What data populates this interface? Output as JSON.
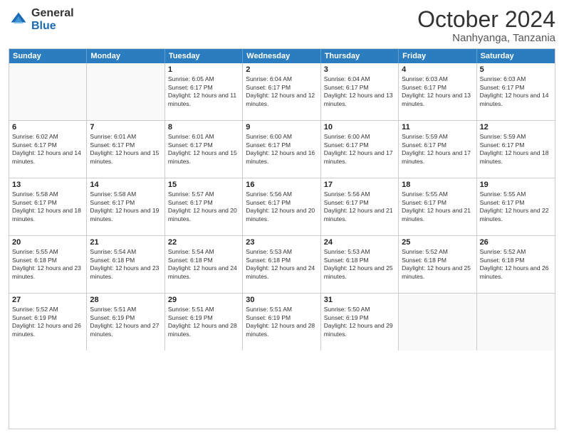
{
  "logo": {
    "general": "General",
    "blue": "Blue"
  },
  "header": {
    "month": "October 2024",
    "location": "Nanhyanga, Tanzania"
  },
  "days": [
    "Sunday",
    "Monday",
    "Tuesday",
    "Wednesday",
    "Thursday",
    "Friday",
    "Saturday"
  ],
  "weeks": [
    [
      {
        "day": "",
        "empty": true
      },
      {
        "day": "",
        "empty": true
      },
      {
        "day": "1",
        "sunrise": "6:05 AM",
        "sunset": "6:17 PM",
        "daylight": "12 hours and 11 minutes."
      },
      {
        "day": "2",
        "sunrise": "6:04 AM",
        "sunset": "6:17 PM",
        "daylight": "12 hours and 12 minutes."
      },
      {
        "day": "3",
        "sunrise": "6:04 AM",
        "sunset": "6:17 PM",
        "daylight": "12 hours and 13 minutes."
      },
      {
        "day": "4",
        "sunrise": "6:03 AM",
        "sunset": "6:17 PM",
        "daylight": "12 hours and 13 minutes."
      },
      {
        "day": "5",
        "sunrise": "6:03 AM",
        "sunset": "6:17 PM",
        "daylight": "12 hours and 14 minutes."
      }
    ],
    [
      {
        "day": "6",
        "sunrise": "6:02 AM",
        "sunset": "6:17 PM",
        "daylight": "12 hours and 14 minutes."
      },
      {
        "day": "7",
        "sunrise": "6:01 AM",
        "sunset": "6:17 PM",
        "daylight": "12 hours and 15 minutes."
      },
      {
        "day": "8",
        "sunrise": "6:01 AM",
        "sunset": "6:17 PM",
        "daylight": "12 hours and 15 minutes."
      },
      {
        "day": "9",
        "sunrise": "6:00 AM",
        "sunset": "6:17 PM",
        "daylight": "12 hours and 16 minutes."
      },
      {
        "day": "10",
        "sunrise": "6:00 AM",
        "sunset": "6:17 PM",
        "daylight": "12 hours and 17 minutes."
      },
      {
        "day": "11",
        "sunrise": "5:59 AM",
        "sunset": "6:17 PM",
        "daylight": "12 hours and 17 minutes."
      },
      {
        "day": "12",
        "sunrise": "5:59 AM",
        "sunset": "6:17 PM",
        "daylight": "12 hours and 18 minutes."
      }
    ],
    [
      {
        "day": "13",
        "sunrise": "5:58 AM",
        "sunset": "6:17 PM",
        "daylight": "12 hours and 18 minutes."
      },
      {
        "day": "14",
        "sunrise": "5:58 AM",
        "sunset": "6:17 PM",
        "daylight": "12 hours and 19 minutes."
      },
      {
        "day": "15",
        "sunrise": "5:57 AM",
        "sunset": "6:17 PM",
        "daylight": "12 hours and 20 minutes."
      },
      {
        "day": "16",
        "sunrise": "5:56 AM",
        "sunset": "6:17 PM",
        "daylight": "12 hours and 20 minutes."
      },
      {
        "day": "17",
        "sunrise": "5:56 AM",
        "sunset": "6:17 PM",
        "daylight": "12 hours and 21 minutes."
      },
      {
        "day": "18",
        "sunrise": "5:55 AM",
        "sunset": "6:17 PM",
        "daylight": "12 hours and 21 minutes."
      },
      {
        "day": "19",
        "sunrise": "5:55 AM",
        "sunset": "6:17 PM",
        "daylight": "12 hours and 22 minutes."
      }
    ],
    [
      {
        "day": "20",
        "sunrise": "5:55 AM",
        "sunset": "6:18 PM",
        "daylight": "12 hours and 23 minutes."
      },
      {
        "day": "21",
        "sunrise": "5:54 AM",
        "sunset": "6:18 PM",
        "daylight": "12 hours and 23 minutes."
      },
      {
        "day": "22",
        "sunrise": "5:54 AM",
        "sunset": "6:18 PM",
        "daylight": "12 hours and 24 minutes."
      },
      {
        "day": "23",
        "sunrise": "5:53 AM",
        "sunset": "6:18 PM",
        "daylight": "12 hours and 24 minutes."
      },
      {
        "day": "24",
        "sunrise": "5:53 AM",
        "sunset": "6:18 PM",
        "daylight": "12 hours and 25 minutes."
      },
      {
        "day": "25",
        "sunrise": "5:52 AM",
        "sunset": "6:18 PM",
        "daylight": "12 hours and 25 minutes."
      },
      {
        "day": "26",
        "sunrise": "5:52 AM",
        "sunset": "6:18 PM",
        "daylight": "12 hours and 26 minutes."
      }
    ],
    [
      {
        "day": "27",
        "sunrise": "5:52 AM",
        "sunset": "6:19 PM",
        "daylight": "12 hours and 26 minutes."
      },
      {
        "day": "28",
        "sunrise": "5:51 AM",
        "sunset": "6:19 PM",
        "daylight": "12 hours and 27 minutes."
      },
      {
        "day": "29",
        "sunrise": "5:51 AM",
        "sunset": "6:19 PM",
        "daylight": "12 hours and 28 minutes."
      },
      {
        "day": "30",
        "sunrise": "5:51 AM",
        "sunset": "6:19 PM",
        "daylight": "12 hours and 28 minutes."
      },
      {
        "day": "31",
        "sunrise": "5:50 AM",
        "sunset": "6:19 PM",
        "daylight": "12 hours and 29 minutes."
      },
      {
        "day": "",
        "empty": true
      },
      {
        "day": "",
        "empty": true
      }
    ]
  ]
}
